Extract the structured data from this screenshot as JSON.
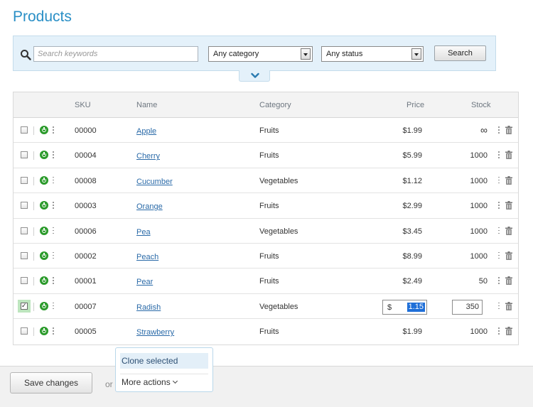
{
  "page": {
    "title": "Products"
  },
  "search": {
    "keyword_placeholder": "Search keywords",
    "keyword_value": "",
    "category_select": "Any category",
    "status_select": "Any status",
    "search_button": "Search"
  },
  "table": {
    "columns": [
      "SKU",
      "Name",
      "Category",
      "Price",
      "Stock"
    ],
    "rows": [
      {
        "sku": "00000",
        "name": "Apple",
        "category": "Fruits",
        "price": "$1.99",
        "stock": "∞",
        "checked": false
      },
      {
        "sku": "00004",
        "name": "Cherry",
        "category": "Fruits",
        "price": "$5.99",
        "stock": "1000",
        "checked": false
      },
      {
        "sku": "00008",
        "name": "Cucumber",
        "category": "Vegetables",
        "price": "$1.12",
        "stock": "1000",
        "checked": false
      },
      {
        "sku": "00003",
        "name": "Orange",
        "category": "Fruits",
        "price": "$2.99",
        "stock": "1000",
        "checked": false
      },
      {
        "sku": "00006",
        "name": "Pea",
        "category": "Vegetables",
        "price": "$3.45",
        "stock": "1000",
        "checked": false
      },
      {
        "sku": "00002",
        "name": "Peach",
        "category": "Fruits",
        "price": "$8.99",
        "stock": "1000",
        "checked": false
      },
      {
        "sku": "00001",
        "name": "Pear",
        "category": "Fruits",
        "price": "$2.49",
        "stock": "50",
        "checked": false
      },
      {
        "sku": "00007",
        "name": "Radish",
        "category": "Vegetables",
        "price_currency": "$",
        "price_edit": "1.15",
        "stock_edit": "350",
        "checked": true
      },
      {
        "sku": "00005",
        "name": "Strawberry",
        "category": "Fruits",
        "price": "$1.99",
        "stock": "1000",
        "checked": false
      }
    ]
  },
  "footer": {
    "save_button": "Save changes",
    "or_label": "or",
    "clone_selected": "Clone selected",
    "more_actions": "More actions"
  },
  "colors": {
    "accent": "#2a8fc6",
    "enabled": "#2a9a2a",
    "link": "#2a6aa8",
    "selection": "#1f6fd8"
  }
}
